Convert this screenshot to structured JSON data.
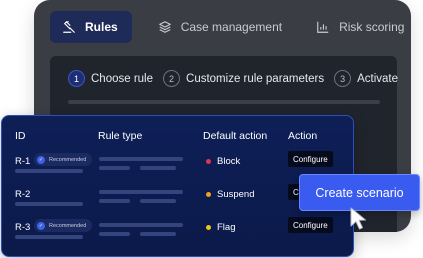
{
  "nav": {
    "tabs": [
      {
        "label": "Rules",
        "icon": "rules-icon",
        "active": true
      },
      {
        "label": "Case management",
        "icon": "layers-icon",
        "active": false
      },
      {
        "label": "Risk scoring",
        "icon": "bar-chart-icon",
        "active": false
      }
    ]
  },
  "stepper": {
    "steps": [
      {
        "num": "1",
        "label": "Choose rule",
        "active": true
      },
      {
        "num": "2",
        "label": "Customize rule parameters",
        "active": false
      },
      {
        "num": "3",
        "label": "Activate",
        "active": false
      }
    ]
  },
  "table": {
    "headers": {
      "id": "ID",
      "rule_type": "Rule type",
      "default_action": "Default action",
      "action": "Action"
    },
    "rows": [
      {
        "id": "R-1",
        "badge": "Recommended",
        "action": "Block",
        "action_color": "#e2344f",
        "button": "Configure"
      },
      {
        "id": "R-2",
        "badge": "",
        "action": "Suspend",
        "action_color": "#f0a21c",
        "button": "Configure"
      },
      {
        "id": "R-3",
        "badge": "Recommended",
        "action": "Flag",
        "action_color": "#f2c31a",
        "button": "Configure"
      }
    ]
  },
  "overlay": {
    "create_label": "Create scenario"
  },
  "colors": {
    "accent": "#3a5bf0",
    "card_bg": "#0e1f57",
    "window_bg": "#3b3d44"
  }
}
